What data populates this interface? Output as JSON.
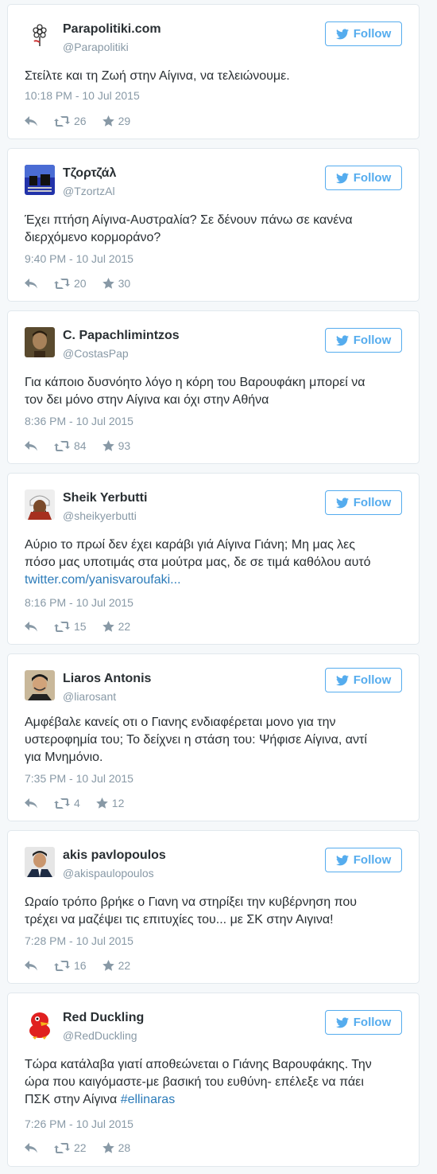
{
  "follow_label": "Follow",
  "accent": "#55acee",
  "tweets": [
    {
      "name": "Parapolitiki.com",
      "handle": "@Parapolitiki",
      "text_lines": [
        "Στείλτε και τη Ζωή στην Αίγινα, να τελειώνουμε."
      ],
      "time": "10:18 PM - 10 Jul 2015",
      "retweets": "26",
      "favorites": "29",
      "avatar_icon": "flower-logo-icon"
    },
    {
      "name": "Τζορτζάλ",
      "handle": "@TzortzAl",
      "text_lines": [
        "Έχει πτήση Αίγινα-Αυστραλία? Σε δένουν πάνω σε κανένα",
        "διερχόμενο κορμοράνο?"
      ],
      "time": "9:40 PM - 10 Jul 2015",
      "retweets": "20",
      "favorites": "30",
      "avatar_icon": "skates-avatar-icon"
    },
    {
      "name": "C. Papachlimintzos",
      "handle": "@CostasPap",
      "text_lines": [
        "Για κάποιο δυσνόητο λόγο η κόρη του Βαρουφάκη μπορεί να",
        "τον δει μόνο στην Αίγινα και όχι στην Αθήνα"
      ],
      "time": "8:36 PM - 10 Jul 2015",
      "retweets": "84",
      "favorites": "93",
      "avatar_icon": "person-avatar-icon"
    },
    {
      "name": "Sheik Yerbutti",
      "handle": "@sheikyerbutti",
      "text_lines": [
        "Αύριο το πρωί δεν έχει καράβι γιά Αίγινα Γιάνη; Μη μας λες",
        "πόσο μας υποτιμάς στα μούτρα μας, δε σε τιμά καθόλου αυτό"
      ],
      "link": "twitter.com/yanisvaroufaki...",
      "time": "8:16 PM - 10 Jul 2015",
      "retweets": "15",
      "favorites": "22",
      "avatar_icon": "sheik-avatar-icon"
    },
    {
      "name": "Liaros Antonis",
      "handle": "@liarosant",
      "text_lines": [
        "Αμφέβαλε κανείς οτι ο Γιανης ενδιαφέρεται μονο για την",
        "υστεροφημία του; Το δείχνει η στάση του: Ψήφισε Αίγινα, αντί",
        "για Μνημόνιο."
      ],
      "time": "7:35 PM - 10 Jul 2015",
      "retweets": "4",
      "favorites": "12",
      "avatar_icon": "person-avatar-icon"
    },
    {
      "name": "akis pavlopoulos",
      "handle": "@akispaulopoulos",
      "text_lines": [
        "Ωραίο τρόπο βρήκε ο Γιανη να στηρίξει την κυβέρνηση που",
        "τρέχει να μαζέψει τις επιτυχίες του... με ΣΚ στην Αιγινα!"
      ],
      "time": "7:28 PM - 10 Jul 2015",
      "retweets": "16",
      "favorites": "22",
      "avatar_icon": "person-avatar-icon"
    },
    {
      "name": "Red Duckling",
      "handle": "@RedDuckling",
      "text_lines": [
        "Τώρα κατάλαβα γιατί αποθεώνεται ο Γιάνης Βαρουφάκης. Την",
        "ώρα που καιγόμαστε-με βασική του ευθύνη- επέλεξε να πάει"
      ],
      "last_line_prefix": "ΠΣΚ στην Αίγινα ",
      "hashtag": "#ellinaras",
      "time": "7:26 PM - 10 Jul 2015",
      "retweets": "22",
      "favorites": "28",
      "avatar_icon": "duck-avatar-icon"
    }
  ]
}
